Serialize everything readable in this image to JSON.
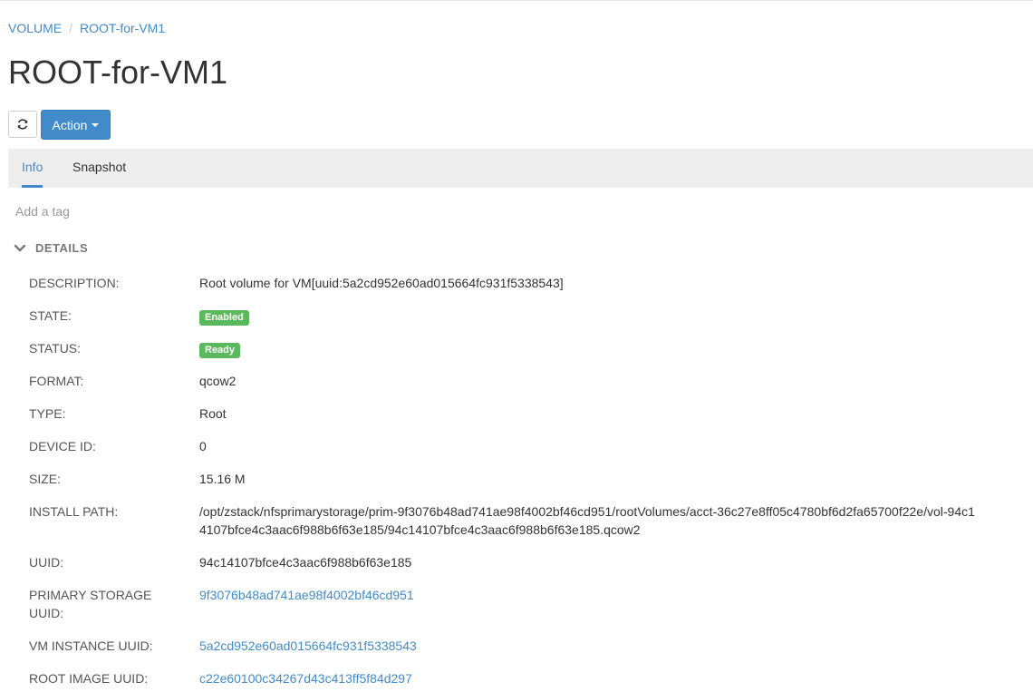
{
  "breadcrumb": {
    "root": "VOLUME",
    "separator": "/",
    "current": "ROOT-for-VM1"
  },
  "page_title": "ROOT-for-VM1",
  "toolbar": {
    "refresh_icon": "refresh-icon",
    "action_label": "Action"
  },
  "tabs": [
    {
      "label": "Info",
      "active": true
    },
    {
      "label": "Snapshot",
      "active": false
    }
  ],
  "add_tag": "Add a tag",
  "section": {
    "title": "DETAILS",
    "icon": "chevron-down-icon"
  },
  "details": {
    "description": {
      "key": "DESCRIPTION:",
      "value": "Root volume for VM[uuid:5a2cd952e60ad015664fc931f5338543]"
    },
    "state": {
      "key": "STATE:",
      "value": "Enabled"
    },
    "status": {
      "key": "STATUS:",
      "value": "Ready"
    },
    "format": {
      "key": "FORMAT:",
      "value": "qcow2"
    },
    "type": {
      "key": "TYPE:",
      "value": "Root"
    },
    "device_id": {
      "key": "DEVICE ID:",
      "value": "0"
    },
    "size": {
      "key": "SIZE:",
      "value": "15.16 M"
    },
    "install_path": {
      "key": "INSTALL PATH:",
      "value": "/opt/zstack/nfsprimarystorage/prim-9f3076b48ad741ae98f4002bf46cd951/rootVolumes/acct-36c27e8ff05c4780bf6d2fa65700f22e/vol-94c14107bfce4c3aac6f988b6f63e185/94c14107bfce4c3aac6f988b6f63e185.qcow2"
    },
    "uuid": {
      "key": "UUID:",
      "value": "94c14107bfce4c3aac6f988b6f63e185"
    },
    "primary_storage_uuid": {
      "key": "PRIMARY STORAGE UUID:",
      "value": "9f3076b48ad741ae98f4002bf46cd951"
    },
    "vm_instance_uuid": {
      "key": "VM INSTANCE UUID:",
      "value": "5a2cd952e60ad015664fc931f5338543"
    },
    "root_image_uuid": {
      "key": "ROOT IMAGE UUID:",
      "value": "c22e60100c34267d43c413ff5f84d297"
    }
  },
  "colors": {
    "accent": "#428bca",
    "success": "#5cb85c",
    "tabbar_bg": "#eeeeee"
  }
}
